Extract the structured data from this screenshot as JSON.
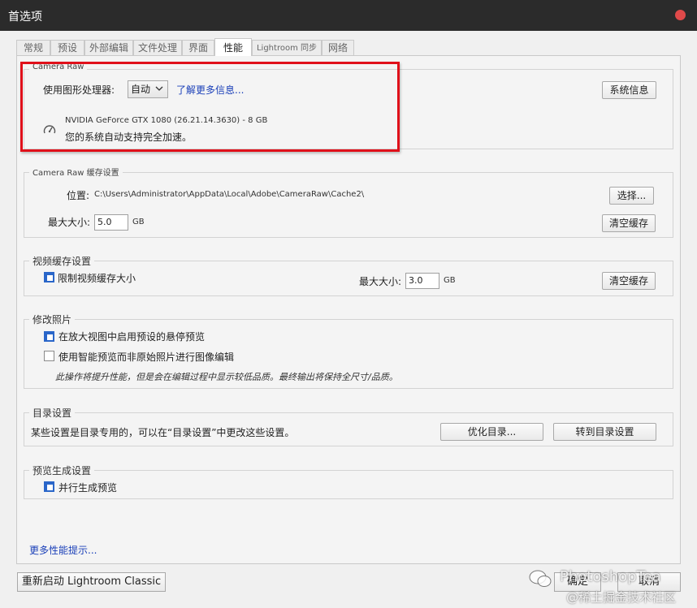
{
  "window": {
    "title": "首选项"
  },
  "tabs": [
    {
      "label": "常规"
    },
    {
      "label": "预设"
    },
    {
      "label": "外部编辑"
    },
    {
      "label": "文件处理"
    },
    {
      "label": "界面"
    },
    {
      "label": "性能"
    },
    {
      "label": "Lightroom 同步"
    },
    {
      "label": "网络"
    }
  ],
  "camera_raw": {
    "title": "Camera Raw",
    "gpu_label": "使用图形处理器:",
    "gpu_value": "自动",
    "learn_more": "了解更多信息...",
    "system_info": "系统信息",
    "gpu_name": "NVIDIA GeForce GTX 1080 (26.21.14.3630) - 8 GB",
    "gpu_status": "您的系统自动支持完全加速。"
  },
  "cache": {
    "title": "Camera Raw 缓存设置",
    "location_label": "位置:",
    "location_value": "C:\\Users\\Administrator\\AppData\\Local\\Adobe\\CameraRaw\\Cache2\\",
    "choose": "选择...",
    "max_label": "最大大小:",
    "max_value": "5.0",
    "unit": "GB",
    "purge": "清空缓存"
  },
  "video_cache": {
    "title": "视频缓存设置",
    "limit_label": "限制视频缓存大小",
    "limit_checked": true,
    "max_label": "最大大小:",
    "max_value": "3.0",
    "unit": "GB",
    "purge": "清空缓存"
  },
  "develop": {
    "title": "修改照片",
    "option1": "在放大视图中启用预设的悬停预览",
    "option1_checked": true,
    "option2": "使用智能预览而非原始照片进行图像编辑",
    "option2_checked": false,
    "note": "此操作将提升性能，但是会在编辑过程中显示较低品质。最终输出将保持全尺寸/品质。"
  },
  "catalog": {
    "title": "目录设置",
    "desc": "某些设置是目录专用的，可以在“目录设置”中更改这些设置。",
    "optimize": "优化目录...",
    "goto": "转到目录设置"
  },
  "preview": {
    "title": "预览生成设置",
    "parallel": "并行生成预览",
    "parallel_checked": true
  },
  "more_tips": "更多性能提示...",
  "footer": {
    "restart": "重新启动 Lightroom Classic",
    "ok": "确定",
    "cancel": "取消",
    "watermark1": "PhotoshopTea",
    "watermark2": "@稀土掘金技术社区"
  },
  "colors": {
    "highlight": "#e0101a",
    "accent": "#2a66c9",
    "link": "#1a3fb8",
    "titlebar": "#2b2b2b"
  }
}
